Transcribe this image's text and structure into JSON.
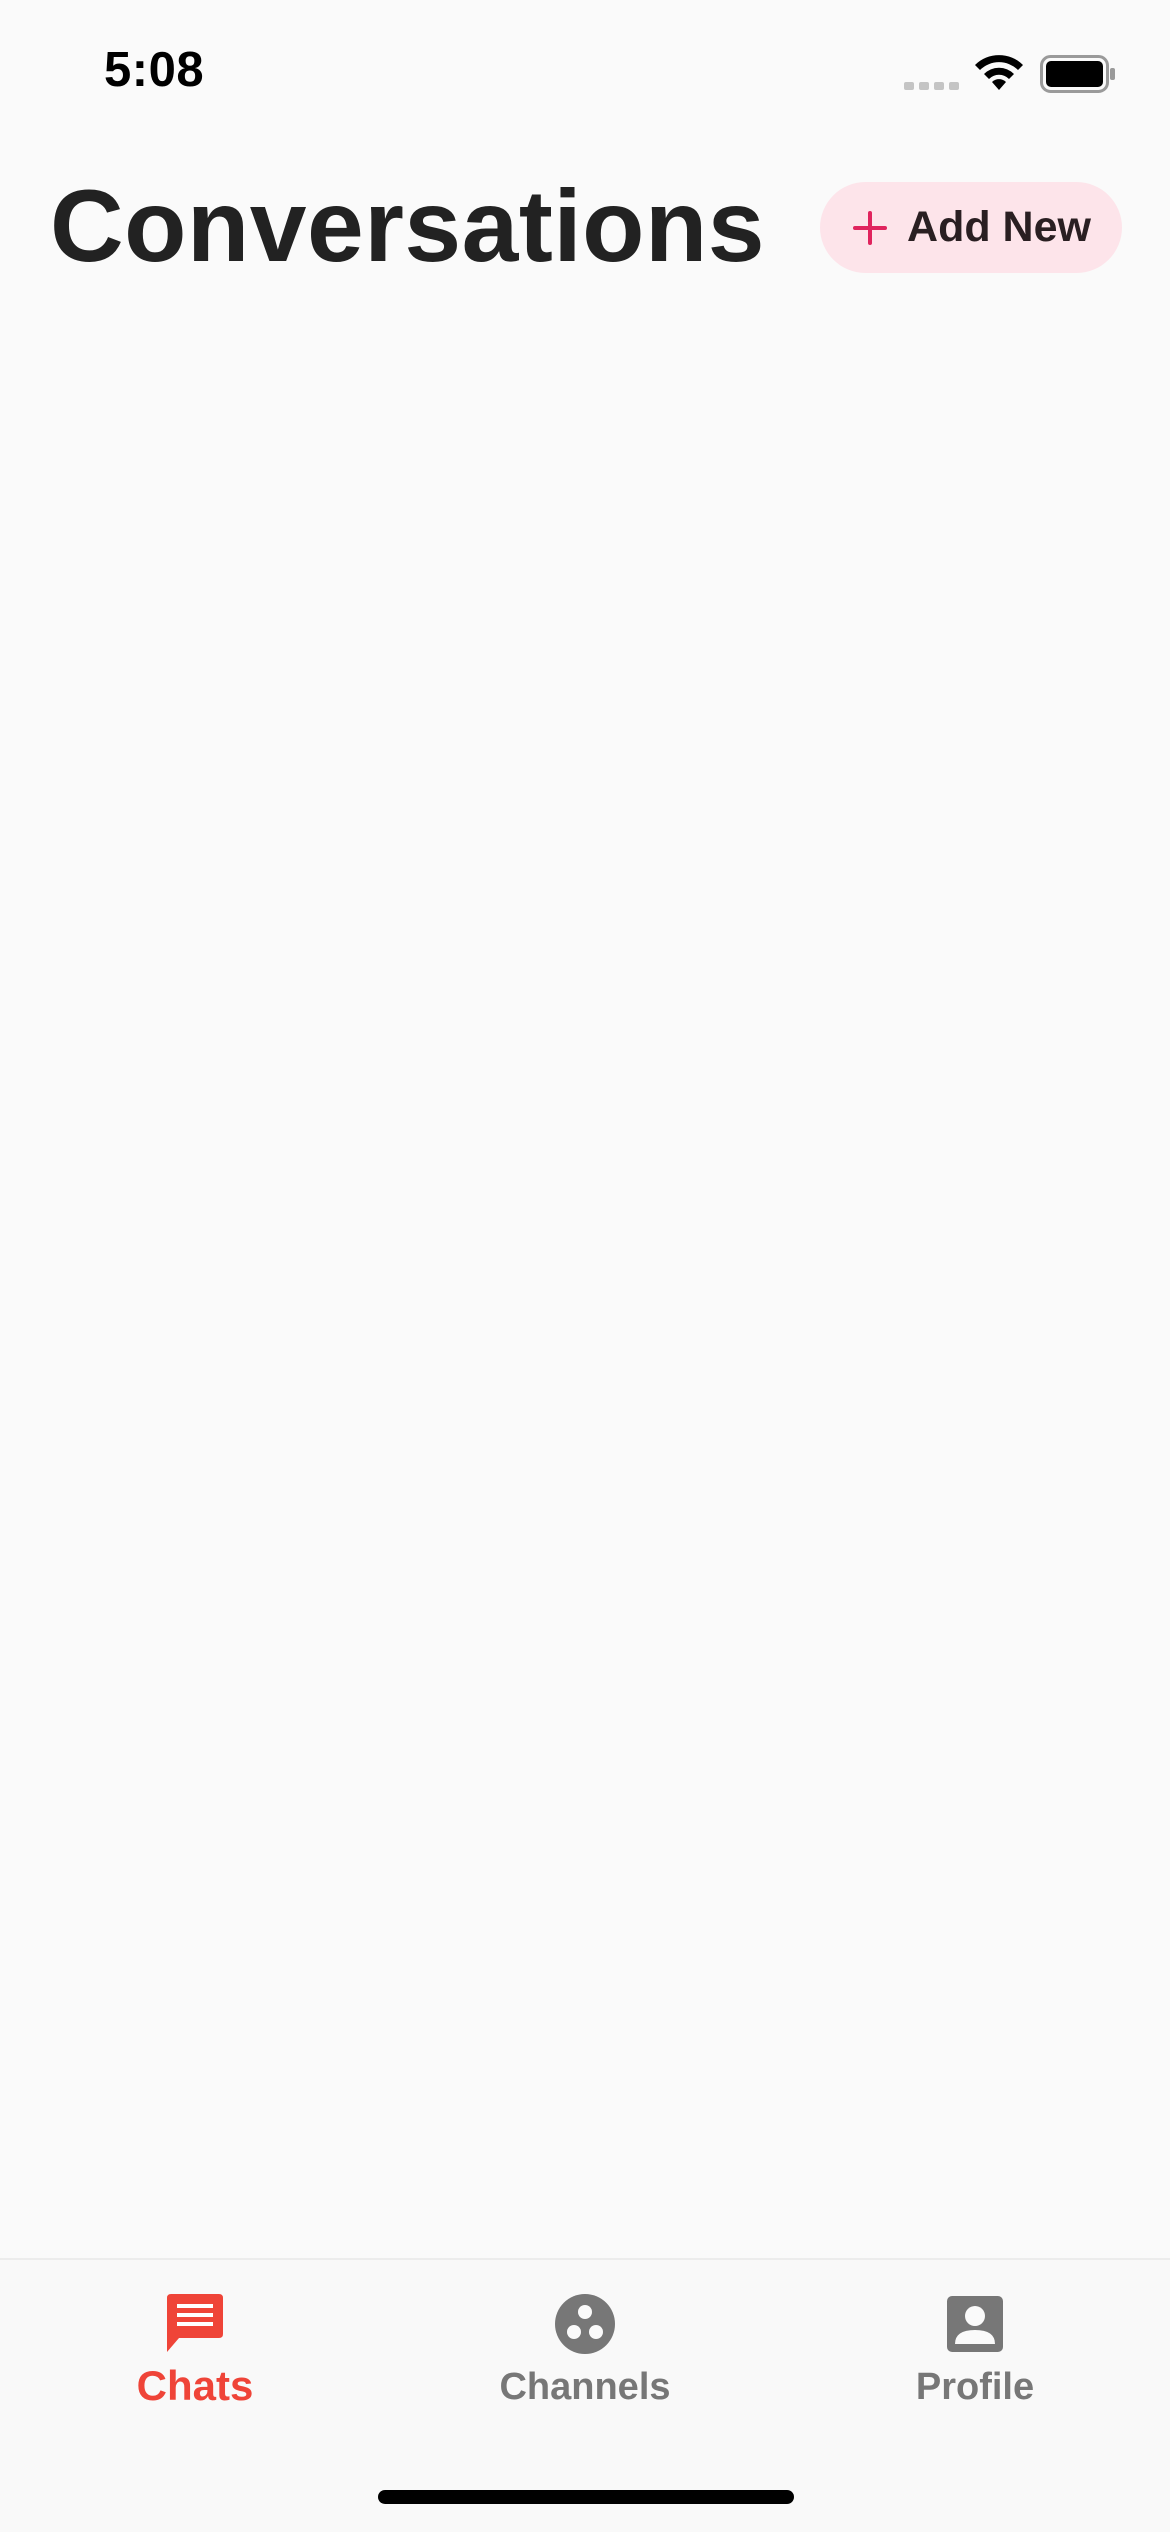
{
  "status_bar": {
    "time": "5:08"
  },
  "header": {
    "title": "Conversations",
    "add_new_label": "Add New"
  },
  "tab_bar": {
    "tabs": [
      {
        "label": "Chats",
        "icon": "chat-icon",
        "active": true
      },
      {
        "label": "Channels",
        "icon": "channels-icon",
        "active": false
      },
      {
        "label": "Profile",
        "icon": "profile-icon",
        "active": false
      }
    ]
  },
  "colors": {
    "accent": "#ef4438",
    "add_button_bg": "#fde4ea",
    "plus_icon": "#e0245e",
    "inactive_tab": "#777777",
    "background": "#fafafa"
  }
}
